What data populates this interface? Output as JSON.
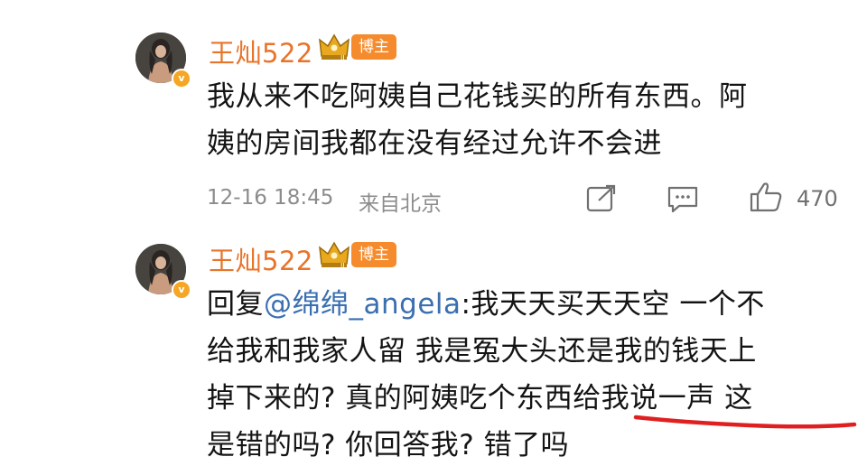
{
  "comments": [
    {
      "username": "王灿522",
      "role_badge": "博主",
      "text_lines": [
        "我从来不吃阿姨自己花钱买的所有东西。阿",
        "姨的房间我都在没有经过允许不会进"
      ],
      "timestamp": "12-16 18:45",
      "location": "来自北京",
      "like_count": "470",
      "icons": [
        "share-icon",
        "comment-icon",
        "like-icon"
      ]
    },
    {
      "username": "王灿522",
      "role_badge": "博主",
      "reply_prefix": "回复",
      "reply_mention": "@绵绵_angela",
      "reply_rest": ":我天天买天天空 一个不",
      "text_lines": [
        "给我和我家人留 我是冤大头还是我的钱天上",
        "掉下来的? 真的阿姨吃个东西给我说一声 这",
        "是错的吗? 你回答我? 错了吗"
      ]
    }
  ],
  "colors": {
    "username": "#e8742a",
    "badge": "#f58b2c",
    "mention": "#3a6fb0",
    "meta": "#8c8c8c",
    "underline": "#e02020"
  }
}
